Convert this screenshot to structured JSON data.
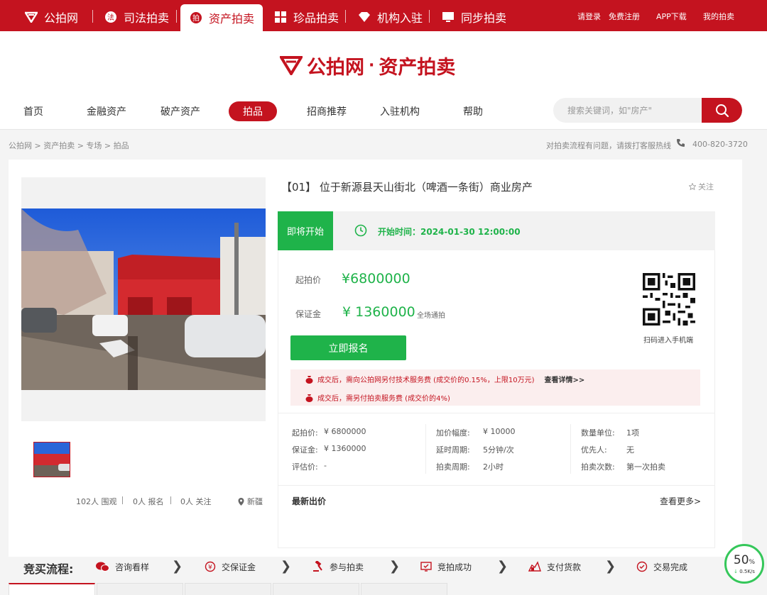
{
  "topbar": {
    "items": [
      {
        "label": "公拍网",
        "icon": "gongpai-logo-icon"
      },
      {
        "label": "司法拍卖",
        "icon": "judicial-icon"
      },
      {
        "label": "资产拍卖",
        "icon": "asset-icon",
        "active": true
      },
      {
        "label": "珍品拍卖",
        "icon": "treasure-icon"
      },
      {
        "label": "机构入驻",
        "icon": "diamond-icon"
      },
      {
        "label": "同步拍卖",
        "icon": "sync-screen-icon"
      }
    ],
    "links": [
      "请登录",
      "免费注册",
      "APP下载",
      "我的拍卖"
    ]
  },
  "logo": {
    "brand": "公拍网",
    "dot": "·",
    "section": "资产拍卖"
  },
  "mainnav": {
    "items": [
      "首页",
      "金融资产",
      "破产资产",
      "拍品",
      "招商推荐",
      "入驻机构",
      "帮助"
    ],
    "active_index": 3
  },
  "search": {
    "placeholder": "搜索关键词，如\"房产\""
  },
  "breadcrumb": "公拍网 > 资产拍卖 > 专场 > 拍品",
  "hotline": {
    "text": "对拍卖流程有问题，请拨打客服热线",
    "number": "400-820-3720"
  },
  "item": {
    "title": "【01】 位于新源县天山街北（啤酒一条街）商业房产",
    "follow_label": "关注",
    "status": "即将开始",
    "start_time": "开始时间：2024-01-30 12:00:00",
    "start_price_label": "起拍价",
    "start_price": "¥6800000",
    "deposit_label": "保证金",
    "deposit": "¥ 1360000",
    "deposit_note": "全场通拍",
    "signup_label": "立即报名",
    "qr_caption": "扫码进入手机端",
    "notice1": "成交后，需向公拍网另付技术服务费 (成交价的0.15%，上限10万元)",
    "notice1_more": "查看详情>>",
    "notice2": "成交后，需另付拍卖服务费 (成交价的4%)",
    "specs": [
      [
        {
          "k": "起拍价:",
          "v": "¥ 6800000"
        },
        {
          "k": "保证金:",
          "v": "¥ 1360000"
        },
        {
          "k": "评估价:",
          "v": "-"
        }
      ],
      [
        {
          "k": "加价幅度:",
          "v": "¥ 10000"
        },
        {
          "k": "延时周期:",
          "v": "5分钟/次"
        },
        {
          "k": "拍卖周期:",
          "v": "2小时"
        }
      ],
      [
        {
          "k": "数量单位:",
          "v": "1项"
        },
        {
          "k": "优先人:",
          "v": "无"
        },
        {
          "k": "拍卖次数:",
          "v": "第一次拍卖"
        }
      ]
    ],
    "latest_bid": "最新出价",
    "see_more": "查看更多>"
  },
  "stats": {
    "views": "102人 围观",
    "signups": "0人 报名",
    "follows": "0人 关注",
    "location": "新疆"
  },
  "flow": {
    "title": "竞买流程:",
    "steps": [
      {
        "label": "咨询看样",
        "icon": "chat-icon"
      },
      {
        "label": "交保证金",
        "icon": "yuan-coin-icon"
      },
      {
        "label": "参与拍卖",
        "icon": "gavel-icon"
      },
      {
        "label": "竞拍成功",
        "icon": "success-screen-icon"
      },
      {
        "label": "支付货款",
        "icon": "payment-icon"
      },
      {
        "label": "交易完成",
        "icon": "check-circle-icon"
      }
    ]
  },
  "speed": {
    "percent": "50",
    "unit": "%",
    "rate": "0.5K/s"
  },
  "colors": {
    "brand_red": "#c4131f",
    "accent_green": "#1fb34a"
  }
}
